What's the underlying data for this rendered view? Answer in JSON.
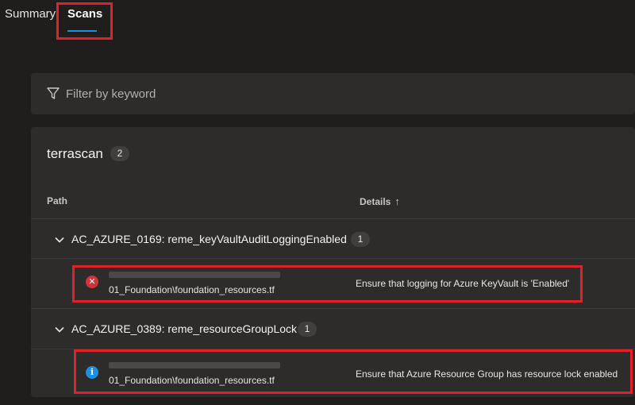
{
  "tabs": {
    "summary": "Summary",
    "scans": "Scans"
  },
  "filter": {
    "placeholder": "Filter by keyword",
    "icon": "filter-icon"
  },
  "panel": {
    "title": "terrascan",
    "count": "2",
    "columns": {
      "path": "Path",
      "details": "Details",
      "details_sort": "↑"
    },
    "groups": [
      {
        "label": "AC_AZURE_0169: reme_keyVaultAuditLoggingEnabled",
        "count": "1",
        "item": {
          "status": "error",
          "status_glyph": "✕",
          "path": "01_Foundation\\foundation_resources.tf",
          "details": "Ensure that logging for Azure KeyVault is 'Enabled'"
        }
      },
      {
        "label": "AC_AZURE_0389: reme_resourceGroupLock",
        "count": "1",
        "item": {
          "status": "info",
          "status_glyph": "i",
          "path": "01_Foundation\\foundation_resources.tf",
          "details": "Ensure that Azure Resource Group has resource lock enabled"
        }
      }
    ]
  },
  "colors": {
    "accent": "#1b8fe0",
    "error": "#d13438",
    "highlight": "#e0202b"
  }
}
